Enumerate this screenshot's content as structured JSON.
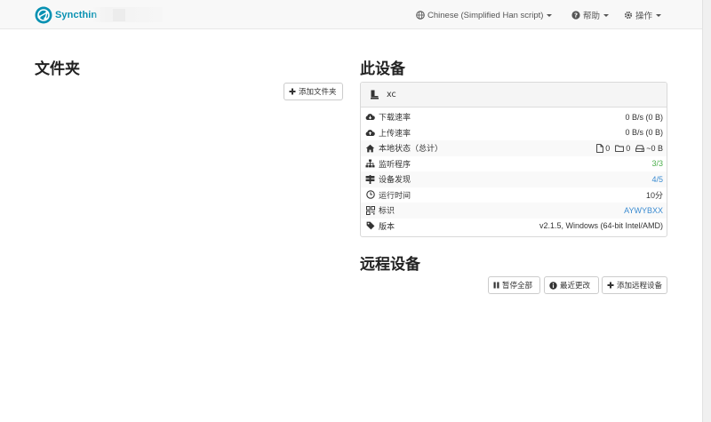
{
  "navbar": {
    "brand": "Syncthin",
    "language": "Chinese (Simplified Han script)",
    "help": "帮助",
    "actions": "操作"
  },
  "folders": {
    "title": "文件夹",
    "add_button": "添加文件夹"
  },
  "this_device": {
    "title": "此设备",
    "name": "xc",
    "rows": [
      {
        "icon": "cloud-download-icon",
        "label": "下载速率",
        "value": "0 B/s (0 B)"
      },
      {
        "icon": "cloud-upload-icon",
        "label": "上传速率",
        "value": "0 B/s (0 B)"
      },
      {
        "icon": "home-icon",
        "label": "本地状态（总计）",
        "files": "0",
        "folders": "0",
        "size": "~0 B"
      },
      {
        "icon": "sitemap-icon",
        "label": "监听程序",
        "value": "3/3"
      },
      {
        "icon": "signpost-icon",
        "label": "设备发现",
        "value": "4/5"
      },
      {
        "icon": "clock-icon",
        "label": "运行时间",
        "value": "10分"
      },
      {
        "icon": "qrcode-icon",
        "label": "标识",
        "value": "AYWYBXX"
      },
      {
        "icon": "tag-icon",
        "label": "版本",
        "value": "v2.1.5, Windows (64-bit Intel/AMD)"
      }
    ]
  },
  "remote_devices": {
    "title": "远程设备",
    "pause_all": "暂停全部",
    "recent_changes": "最近更改",
    "add_device": "添加远程设备"
  },
  "colors": {
    "brand": "#0891b2",
    "ok": "#4cae4c",
    "link": "#3a8bd1"
  }
}
